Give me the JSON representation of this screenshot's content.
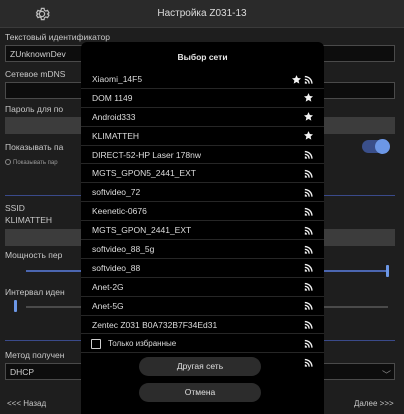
{
  "header": {
    "title": "Настройка Z031-13",
    "icon": "gear-icon"
  },
  "background": {
    "text_id_label": "Текстовый идентификатор",
    "text_id_value": "ZUnknownDev",
    "mdns_label": "Сетевое mDNS",
    "password_label": "Пароль для по",
    "show_label": "Показывать па",
    "show_small_label": "Показывать пар",
    "ssid_label": "SSID",
    "ssid_value": "KLIMATTEH",
    "power_label": "Мощность пер",
    "interval_label": "Интервал иден",
    "method_label": "Метод получен",
    "method_value": "DHCP",
    "back_label": "<<< Назад",
    "next_label": "Далее >>>"
  },
  "modal": {
    "title": "Выбор сети",
    "networks": [
      {
        "ssid": "Xiaomi_14F5",
        "favorite": true,
        "signal": true
      },
      {
        "ssid": "DOM 1149",
        "favorite": true,
        "signal": false
      },
      {
        "ssid": "Android333",
        "favorite": true,
        "signal": false
      },
      {
        "ssid": "KLIMATTEH",
        "favorite": true,
        "signal": false
      },
      {
        "ssid": "DIRECT-52-HP Laser 178nw",
        "favorite": false,
        "signal": true
      },
      {
        "ssid": "MGTS_GPON5_2441_EXT",
        "favorite": false,
        "signal": true
      },
      {
        "ssid": "softvideo_72",
        "favorite": false,
        "signal": true
      },
      {
        "ssid": "Keenetic-0676",
        "favorite": false,
        "signal": true
      },
      {
        "ssid": "MGTS_GPON_2441_EXT",
        "favorite": false,
        "signal": true
      },
      {
        "ssid": "softvideo_88_5g",
        "favorite": false,
        "signal": true
      },
      {
        "ssid": "softvideo_88",
        "favorite": false,
        "signal": true
      },
      {
        "ssid": "Anet-2G",
        "favorite": false,
        "signal": true
      },
      {
        "ssid": "Anet-5G",
        "favorite": false,
        "signal": true
      },
      {
        "ssid": "Zentec Z031 B0A732B7F34Ed31",
        "favorite": false,
        "signal": true
      },
      {
        "ssid": "",
        "favorite": false,
        "signal": true
      },
      {
        "ssid": "",
        "favorite": false,
        "signal": true
      }
    ],
    "favorites_only_label": "Только избранные",
    "favorites_only_checked": false,
    "other_network_label": "Другая сеть",
    "cancel_label": "Отмена"
  },
  "colors": {
    "accent": "#6c97e6",
    "modal_bg": "#000000",
    "page_bg": "#1e1e1e"
  }
}
